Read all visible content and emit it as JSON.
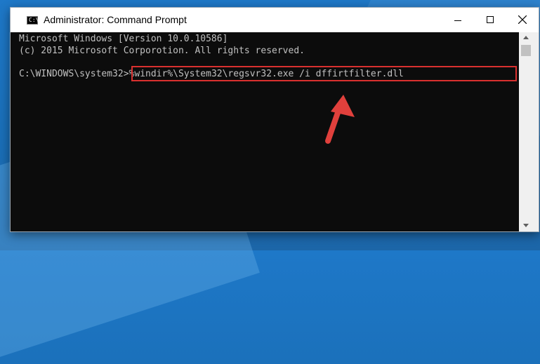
{
  "window": {
    "title": "Administrator: Command Prompt",
    "app_icon": "cmd-icon",
    "controls": [
      "minimize-icon",
      "maximize-icon",
      "close-icon"
    ]
  },
  "console": {
    "line1": "Microsoft Windows [Version 10.0.10586]",
    "line2": "(c) 2015 Microsoft Corporotion. All rights reserved.",
    "prompt": "C:\\WINDOWS\\system32>",
    "command": "%windir%\\System32\\regsvr32.exe /i dffirtfilter.dll"
  },
  "colors": {
    "highlight": "#d9302f",
    "arrow": "#e0403c",
    "console_bg": "#0c0c0c",
    "console_text": "#c0c0c0"
  }
}
